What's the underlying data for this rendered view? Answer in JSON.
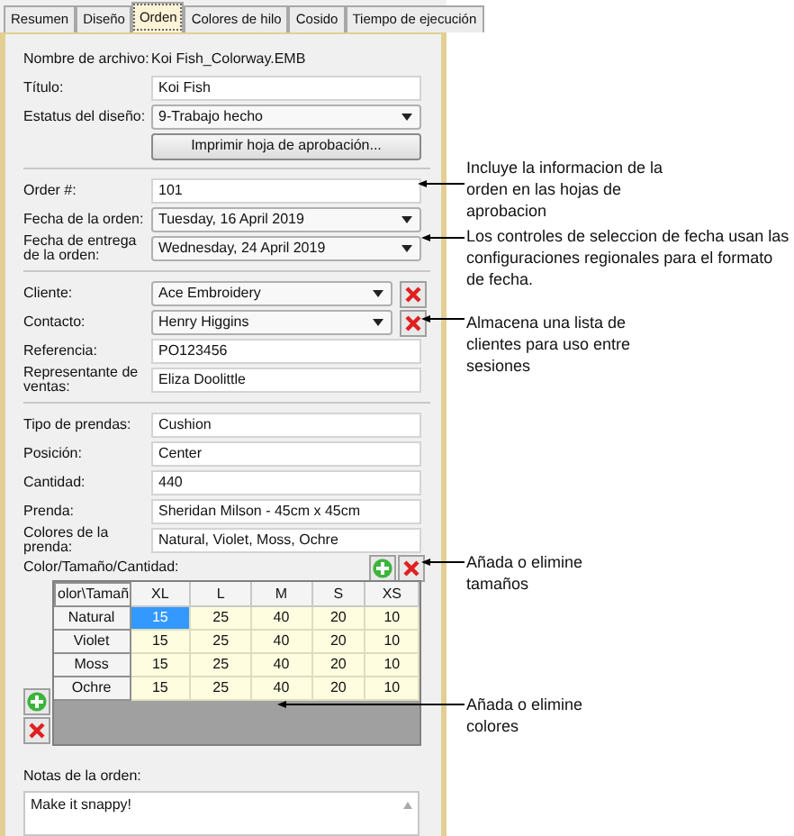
{
  "tabs": [
    {
      "label": "Resumen",
      "selected": false
    },
    {
      "label": "Diseño",
      "selected": false
    },
    {
      "label": "Orden",
      "selected": true
    },
    {
      "label": "Colores de hilo",
      "selected": false
    },
    {
      "label": "Cosido",
      "selected": false
    },
    {
      "label": "Tiempo de ejecución",
      "selected": false
    }
  ],
  "sections": [
    {
      "rows": [
        {
          "kind": "static",
          "label": "Nombre de archivo:",
          "value": "Koi Fish_Colorway.EMB"
        },
        {
          "kind": "input",
          "label": "Título:",
          "value": "Koi Fish"
        },
        {
          "kind": "dropdown",
          "label": "Estatus del diseño:",
          "value": "9-Trabajo hecho"
        },
        {
          "kind": "button",
          "value": "Imprimir hoja de aprobación..."
        }
      ]
    },
    {
      "rows": [
        {
          "kind": "input",
          "label": "Order #:",
          "value": "101"
        },
        {
          "kind": "dropdown",
          "label": "Fecha de la orden:",
          "value": "Tuesday, 16 April 2019"
        },
        {
          "kind": "dropdown",
          "label": "Fecha de entrega de la orden:",
          "value": "Wednesday, 24 April 2019"
        }
      ]
    },
    {
      "rows": [
        {
          "kind": "dropdown",
          "label": "Cliente:",
          "value": "Ace Embroidery",
          "removable": true
        },
        {
          "kind": "dropdown",
          "label": "Contacto:",
          "value": "Henry Higgins",
          "removable": true
        },
        {
          "kind": "input",
          "label": "Referencia:",
          "value": "PO123456"
        },
        {
          "kind": "input",
          "label": "Representante de ventas:",
          "value": "Eliza Doolittle"
        }
      ]
    },
    {
      "rows": [
        {
          "kind": "input",
          "label": "Tipo de prendas:",
          "value": "Cushion"
        },
        {
          "kind": "input",
          "label": "Posición:",
          "value": "Center"
        },
        {
          "kind": "input",
          "label": "Cantidad:",
          "value": "440"
        },
        {
          "kind": "input",
          "label": "Prenda:",
          "value": "Sheridan Milson - 45cm x 45cm"
        },
        {
          "kind": "input",
          "label": "Colores de la prenda:",
          "value": "Natural, Violet, Moss, Ochre"
        }
      ]
    }
  ],
  "grid": {
    "label": "Color/Tamaño/Cantidad:",
    "corner": "olor\\Tamañ",
    "columns": [
      "XL",
      "L",
      "M",
      "S",
      "XS"
    ],
    "rows": [
      {
        "label": "Natural",
        "cells": [
          {
            "value": "15",
            "selected": true
          },
          {
            "value": "25",
            "selected": false
          },
          {
            "value": "40",
            "selected": false
          },
          {
            "value": "20",
            "selected": false
          },
          {
            "value": "10",
            "selected": false
          }
        ]
      },
      {
        "label": "Violet",
        "cells": [
          {
            "value": "15",
            "selected": false
          },
          {
            "value": "25",
            "selected": false
          },
          {
            "value": "40",
            "selected": false
          },
          {
            "value": "20",
            "selected": false
          },
          {
            "value": "10",
            "selected": false
          }
        ]
      },
      {
        "label": "Moss",
        "cells": [
          {
            "value": "15",
            "selected": false
          },
          {
            "value": "25",
            "selected": false
          },
          {
            "value": "40",
            "selected": false
          },
          {
            "value": "20",
            "selected": false
          },
          {
            "value": "10",
            "selected": false
          }
        ]
      },
      {
        "label": "Ochre",
        "cells": [
          {
            "value": "15",
            "selected": false
          },
          {
            "value": "25",
            "selected": false
          },
          {
            "value": "40",
            "selected": false
          },
          {
            "value": "20",
            "selected": false
          },
          {
            "value": "10",
            "selected": false
          }
        ]
      }
    ]
  },
  "notes": {
    "label": "Notas de la orden:",
    "value": "Make it snappy!"
  },
  "annotations": [
    "Incluye la informacion de la orden en las hojas de aprobacion",
    "Los controles de seleccion de fecha usan las configuraciones regionales para el formato de fecha.",
    "Almacena una lista de clientes para uso entre sesiones",
    "Añada o elimine tamaños",
    "Añada o elimine colores"
  ]
}
